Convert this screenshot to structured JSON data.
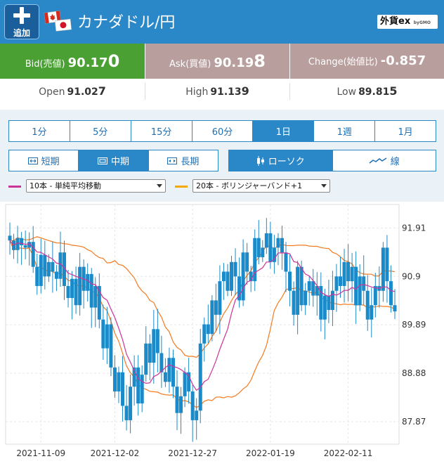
{
  "header": {
    "add_label": "追加",
    "pair": "カナダドル/円",
    "logo_main": "外貨ex",
    "logo_sub": "byGMO",
    "colors": {
      "header": "#2a87c8",
      "add_button": "#1a5f9c"
    }
  },
  "quotes": {
    "bid": {
      "label": "Bid(売値)",
      "value_main": "90.17",
      "value_last": "0"
    },
    "ask": {
      "label": "Ask(買値)",
      "value_main": "90.19",
      "value_last": "8"
    },
    "change": {
      "label": "Change(始値比)",
      "value": "-0.857"
    },
    "colors": {
      "bid": "#4aa032",
      "ask": "#b89e9c",
      "change": "#b89e9c"
    }
  },
  "stats": {
    "open": {
      "label": "Open",
      "value_main": "91.02",
      "value_last": "7"
    },
    "high": {
      "label": "High",
      "value_main": "91.13",
      "value_last": "9"
    },
    "low": {
      "label": "Low",
      "value_main": "89.81",
      "value_last": "5"
    }
  },
  "timeframes": {
    "items": [
      "1分",
      "5分",
      "15分",
      "60分",
      "1日",
      "1週",
      "1月"
    ],
    "active": "1日"
  },
  "ranges": {
    "items": [
      "短期",
      "中期",
      "長期"
    ],
    "active": "中期"
  },
  "chart_types": {
    "items": [
      "ローソク",
      "線"
    ],
    "active": "ローソク"
  },
  "indicators": [
    {
      "value": "10本 - 単純平均移動",
      "color": "#cc3399"
    },
    {
      "value": "20本 - ボリンジャーバンド+1",
      "color": "#f5a800"
    }
  ],
  "chart_data": {
    "type": "candlestick",
    "y_ticks": [
      "91.91",
      "90.9",
      "89.89",
      "88.88",
      "87.87"
    ],
    "x_ticks": [
      "2021-11-09",
      "2021-12-02",
      "2021-12-27",
      "2022-01-19",
      "2022-02-11"
    ],
    "ylim": [
      87.4,
      92.4
    ],
    "grid": true,
    "candle_color": "#1b8ac8",
    "ma_color": "#cc3399",
    "band_color": "#f47a20",
    "closes": [
      91.65,
      91.45,
      91.7,
      91.55,
      91.5,
      91.62,
      91.1,
      90.7,
      91.35,
      90.9,
      91.2,
      91.0,
      90.85,
      91.4,
      90.7,
      90.45,
      90.85,
      90.3,
      91.1,
      90.6,
      90.95,
      90.25,
      90.7,
      90.0,
      89.4,
      89.9,
      89.0,
      88.5,
      88.9,
      88.2,
      87.9,
      88.6,
      89.0,
      88.25,
      88.85,
      89.5,
      89.1,
      89.8,
      89.3,
      88.9,
      88.7,
      89.2,
      88.6,
      88.05,
      88.4,
      88.9,
      88.5,
      87.9,
      88.1,
      89.5,
      89.9,
      89.7,
      90.4,
      90.1,
      90.8,
      91.0,
      90.6,
      91.2,
      90.9,
      90.4,
      91.4,
      91.0,
      90.8,
      91.7,
      91.3,
      91.5,
      91.8,
      91.2,
      91.5,
      91.7,
      91.4,
      91.0,
      90.6,
      90.1,
      91.1,
      90.3,
      90.6,
      90.8,
      90.5,
      90.7,
      90.0,
      90.5,
      90.2,
      90.6,
      90.9,
      90.7,
      91.2,
      90.8,
      91.1,
      90.3,
      90.9,
      90.6,
      90.0,
      90.3,
      90.7,
      90.6,
      91.5,
      90.8,
      90.3,
      90.17
    ]
  }
}
